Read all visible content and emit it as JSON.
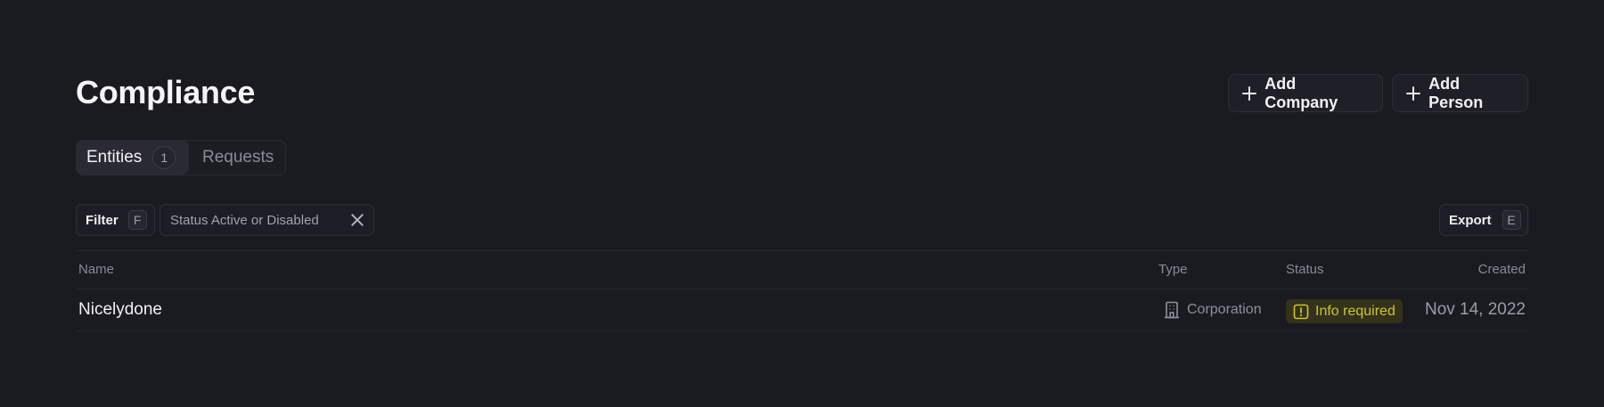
{
  "page": {
    "title": "Compliance"
  },
  "header_actions": {
    "add_company": "Add Company",
    "add_person": "Add Person"
  },
  "tabs": [
    {
      "label": "Entities",
      "count": "1",
      "active": true
    },
    {
      "label": "Requests",
      "active": false
    }
  ],
  "toolbar": {
    "filter_label": "Filter",
    "filter_shortcut": "F",
    "active_filter": "Status Active or Disabled",
    "export_label": "Export",
    "export_shortcut": "E"
  },
  "table": {
    "columns": [
      "Name",
      "Type",
      "Status",
      "Created"
    ],
    "rows": [
      {
        "name": "Nicelydone",
        "type": "Corporation",
        "type_icon": "building-icon",
        "status": "Info required",
        "status_icon": "alert-square-icon",
        "created": "Nov 14, 2022"
      }
    ]
  },
  "colors": {
    "background": "#1a1a21",
    "status_warning_text": "#cfc33a",
    "status_warning_bg": "#34321a"
  }
}
